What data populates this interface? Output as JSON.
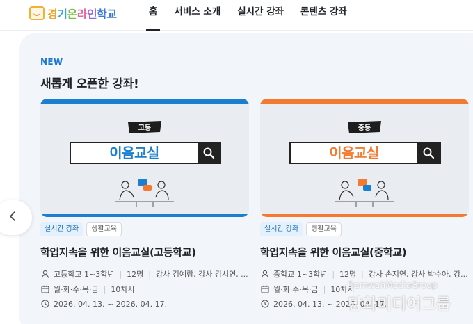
{
  "header": {
    "logo_text": [
      "경",
      "기",
      "온",
      "라",
      "인",
      "학",
      "교"
    ],
    "nav": [
      {
        "label": "홈",
        "active": true
      },
      {
        "label": "서비스 소개"
      },
      {
        "label": "실시간 강좌"
      },
      {
        "label": "콘텐츠 강좌"
      }
    ]
  },
  "section": {
    "new_label": "NEW",
    "title": "새롭게 오픈한 강좌!"
  },
  "cards": [
    {
      "level": "고등",
      "thumb_title": "이음교실",
      "accent": "#1a7fd0",
      "tags": [
        "실시간 강좌",
        "생활교육"
      ],
      "title": "학업지속을 위한 이음교실(고등학교)",
      "target": "고등학교 1~3학년",
      "capacity": "12명",
      "teachers": "강사 김예람, 강사 김시연, ...",
      "days": "월·화·수·목·금",
      "sessions": "10차시",
      "period": "2026. 04. 13. ~ 2026. 04. 17."
    },
    {
      "level": "중등",
      "thumb_title": "이음교실",
      "accent": "#f37a30",
      "tags": [
        "실시간 강좌",
        "생활교육"
      ],
      "title": "학업지속을 위한 이음교실(중학교)",
      "target": "중학교 1~3학년",
      "capacity": "12명",
      "teachers": "강사 손지연, 강사 박수아, 강...",
      "days": "월·화·수·목·금",
      "sessions": "10차시",
      "period": "2026. 04. 13. ~ 2026. 04. 17."
    }
  ],
  "watermark": {
    "line1": "DamwahMediaGroup",
    "line2": "담화미디어그룹"
  }
}
